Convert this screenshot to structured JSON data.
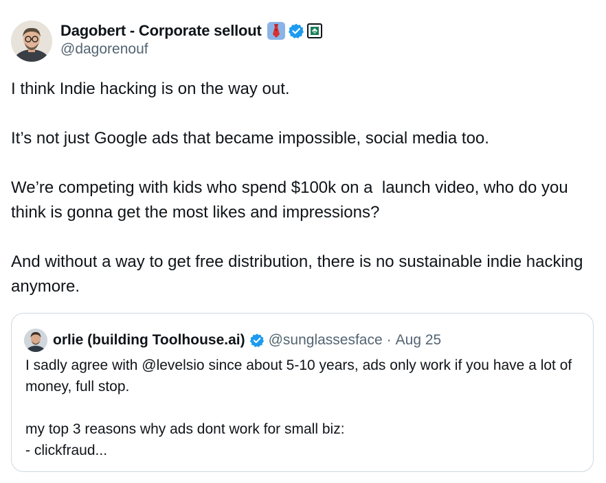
{
  "author": {
    "name": "Dagobert - Corporate sellout",
    "handle": "@dagorenouf",
    "avatar_icon": "person-glasses-avatar",
    "name_badges": [
      "tie-emoji-icon",
      "verified-badge-icon",
      "affiliate-badge-icon"
    ]
  },
  "tweet": {
    "paragraphs": [
      "I think Indie hacking is on the way out.",
      "It’s not just Google ads that became impossible, social media too.",
      "We’re competing with kids who spend $100k on a  launch video, who do you think is gonna get the most likes and impressions?",
      "And without a way to get free distribution, there is no sustainable indie hacking anymore."
    ]
  },
  "quote": {
    "name": "orlie (building Toolhouse.ai)",
    "handle": "@sunglassesface",
    "separator": "·",
    "date": "Aug 25",
    "paragraphs": [
      "I sadly agree with @levelsio since about 5-10 years, ads only work if you have a lot of money, full stop.",
      "my top 3 reasons why ads dont work for small biz:\n- clickfraud..."
    ]
  },
  "colors": {
    "text": "#0f1419",
    "secondary": "#536471",
    "verified": "#1d9bf0",
    "border": "#cfd9de"
  }
}
